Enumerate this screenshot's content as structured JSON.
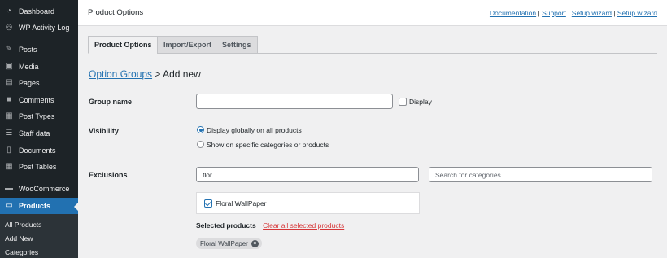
{
  "sidebar": {
    "items": [
      {
        "label": "Dashboard",
        "icon": "dashboard-icon",
        "glyph": "◔"
      },
      {
        "label": "WP Activity Log",
        "icon": "activity-log-icon",
        "glyph": "◎"
      },
      {
        "label": "Posts",
        "icon": "pin-icon",
        "glyph": "✎"
      },
      {
        "label": "Media",
        "icon": "media-icon",
        "glyph": "▣"
      },
      {
        "label": "Pages",
        "icon": "pages-icon",
        "glyph": "▤"
      },
      {
        "label": "Comments",
        "icon": "comments-icon",
        "glyph": "■"
      },
      {
        "label": "Post Types",
        "icon": "post-types-icon",
        "glyph": "▦"
      },
      {
        "label": "Staff data",
        "icon": "staff-data-icon",
        "glyph": "☰"
      },
      {
        "label": "Documents",
        "icon": "documents-icon",
        "glyph": "▯"
      },
      {
        "label": "Post Tables",
        "icon": "post-tables-icon",
        "glyph": "▦"
      },
      {
        "label": "WooCommerce",
        "icon": "woocommerce-icon",
        "glyph": "▬"
      },
      {
        "label": "Products",
        "icon": "products-icon",
        "glyph": "▭"
      }
    ],
    "submenu": [
      "All Products",
      "Add New",
      "Categories"
    ]
  },
  "header": {
    "title": "Product Options",
    "links": [
      "Documentation",
      "Support",
      "Setup wizard",
      "Setup wizard"
    ],
    "separator": " | "
  },
  "tabs": [
    "Product Options",
    "Import/Export",
    "Settings"
  ],
  "breadcrumb": {
    "link": "Option Groups",
    "separator": " > ",
    "current": "Add new"
  },
  "form": {
    "group_name": {
      "label": "Group name",
      "value": "",
      "display_label": "Display"
    },
    "visibility": {
      "label": "Visibility",
      "options": [
        "Display globally on all products",
        "Show on specific categories or products"
      ],
      "selected": 0
    },
    "exclusions": {
      "label": "Exclusions",
      "search_value": "flor",
      "categories_placeholder": "Search for categories",
      "result": "Floral WallPaper",
      "selected_label": "Selected products",
      "clear_label": "Clear all selected products",
      "tags": [
        "Floral WallPaper"
      ]
    }
  },
  "colors": {
    "accent": "#2271b1",
    "sidebar": "#1d2327",
    "danger": "#d63638"
  }
}
